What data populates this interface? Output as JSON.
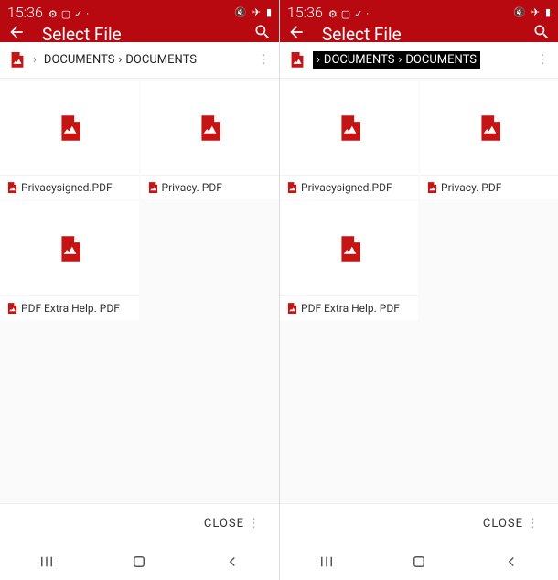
{
  "accent": "#c41414",
  "phones": {
    "a": {
      "time": "15:36",
      "title": "Select File",
      "breadcrumb": {
        "seg1": "DOCUMENTS",
        "seg2": "DOCUMENTS"
      },
      "files": [
        {
          "name": "Privacysigned.PDF"
        },
        {
          "name": "Privacy. PDF"
        },
        {
          "name": "PDF Extra Help. PDF"
        }
      ],
      "footer": {
        "close": "CLOSE"
      }
    },
    "b": {
      "time": "15:36",
      "title": "Select File",
      "breadcrumb": {
        "seg1": "DOCUMENTS",
        "seg2": "DOCUMENTS"
      },
      "files": [
        {
          "name": "Privacysigned.PDF"
        },
        {
          "name": "Privacy. PDF"
        },
        {
          "name": "PDF Extra Help. PDF"
        }
      ],
      "footer": {
        "close": "CLOSE"
      }
    }
  },
  "icons": {
    "gear": "gear-icon",
    "image": "image-icon",
    "check": "check-icon",
    "mute": "mute-icon",
    "airplane": "airplane-icon",
    "battery": "battery-icon",
    "back": "back-icon",
    "search": "search-icon",
    "pdf": "pdf-icon",
    "chevron": "chevron-right-icon",
    "more": "more-vert-icon",
    "nav_recent": "nav-recent-icon",
    "nav_home": "nav-home-icon",
    "nav_back": "nav-back-icon"
  }
}
